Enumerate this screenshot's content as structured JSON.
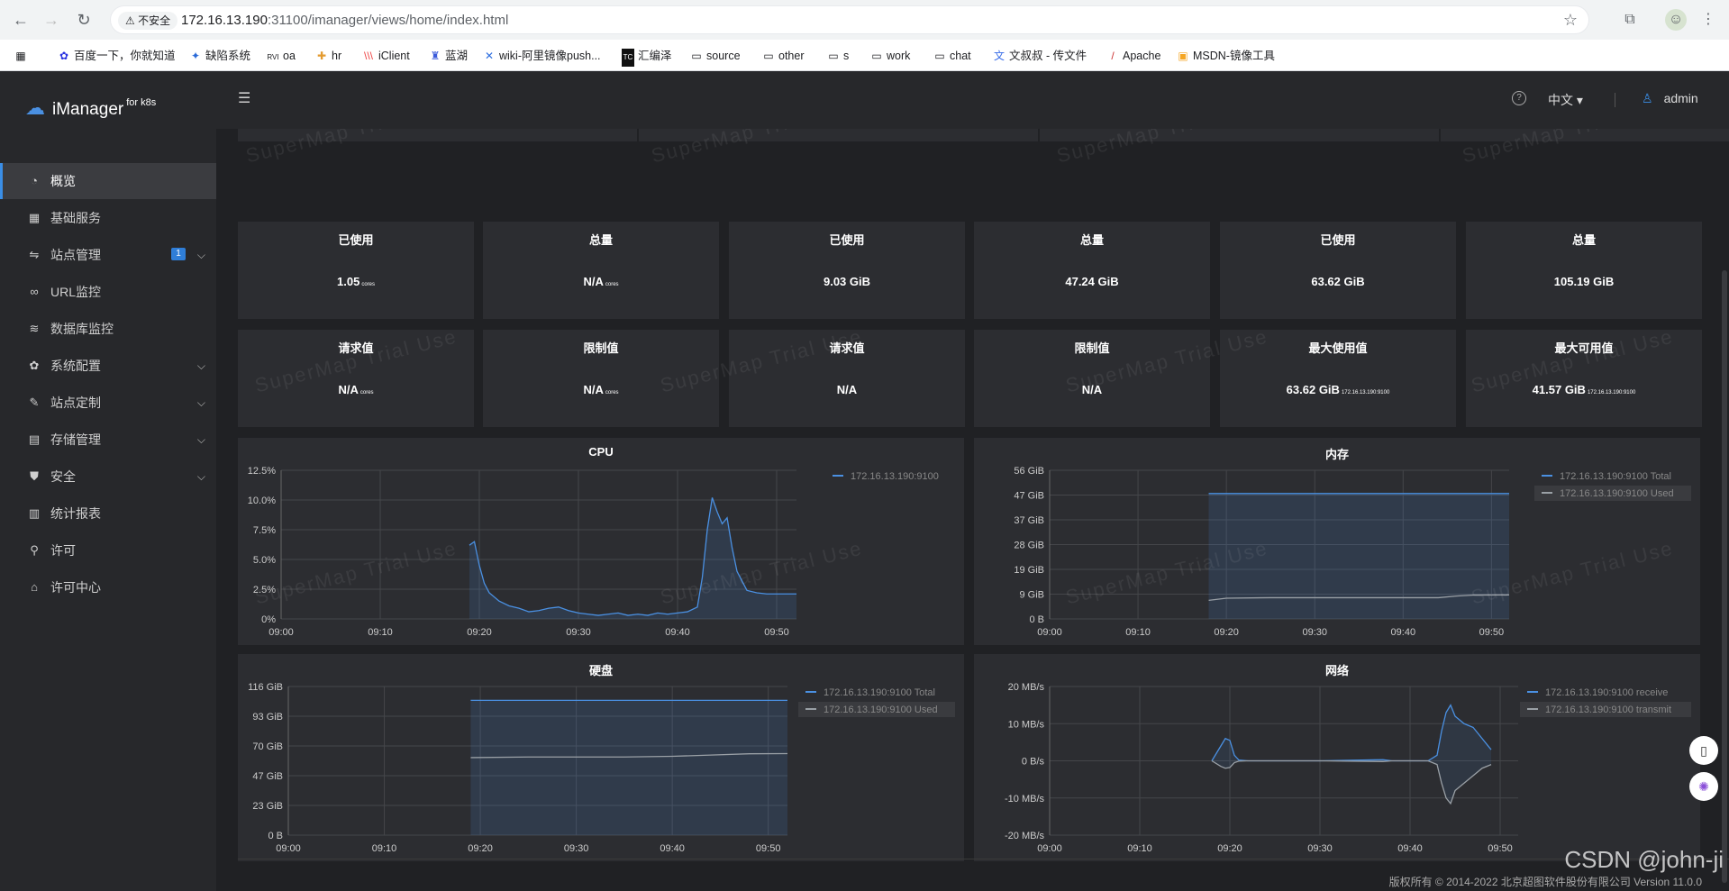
{
  "browser": {
    "security_label": "不安全",
    "url_host": "172.16.13.190",
    "url_rest": ":31100/imanager/views/home/index.html",
    "bookmarks": [
      "百度一下，你就知道",
      "缺陷系统",
      "oa",
      "hr",
      "iClient",
      "蓝湖",
      "wiki-阿里镜像push...",
      "汇编泽",
      "source",
      "other",
      "s",
      "work",
      "chat",
      "文叔叔 - 传文件",
      "Apache",
      "MSDN-镜像工具"
    ]
  },
  "app": {
    "logo_text": "iManager",
    "logo_sup": "for k8s",
    "lang": "中文",
    "user": "admin",
    "help": "?",
    "menu": [
      {
        "label": "概览",
        "active": true,
        "icon": "dashboard-icon"
      },
      {
        "label": "基础服务",
        "icon": "grid-icon"
      },
      {
        "label": "站点管理",
        "icon": "share-icon",
        "badge": "1",
        "expand": true
      },
      {
        "label": "URL监控",
        "icon": "link-icon"
      },
      {
        "label": "数据库监控",
        "icon": "database-icon"
      },
      {
        "label": "系统配置",
        "icon": "gear-icon",
        "expand": true
      },
      {
        "label": "站点定制",
        "icon": "wrench-icon",
        "expand": true
      },
      {
        "label": "存储管理",
        "icon": "storage-icon",
        "expand": true
      },
      {
        "label": "安全",
        "icon": "shield-icon",
        "expand": true
      },
      {
        "label": "统计报表",
        "icon": "report-icon"
      },
      {
        "label": "许可",
        "icon": "license-icon"
      },
      {
        "label": "许可中心",
        "icon": "home-icon"
      }
    ]
  },
  "stats_row1": [
    {
      "label": "已使用",
      "value": "1.05",
      "unit": "cores"
    },
    {
      "label": "总量",
      "value": "N/A",
      "unit": "cores"
    },
    {
      "label": "已使用",
      "value": "9.03 GiB",
      "unit": ""
    },
    {
      "label": "总量",
      "value": "47.24 GiB",
      "unit": ""
    },
    {
      "label": "已使用",
      "value": "63.62 GiB",
      "unit": ""
    },
    {
      "label": "总量",
      "value": "105.19 GiB",
      "unit": ""
    }
  ],
  "stats_row2": [
    {
      "label": "请求值",
      "value": "N/A",
      "unit": "cores"
    },
    {
      "label": "限制值",
      "value": "N/A",
      "unit": "cores"
    },
    {
      "label": "请求值",
      "value": "N/A",
      "unit": ""
    },
    {
      "label": "限制值",
      "value": "N/A",
      "unit": ""
    },
    {
      "label": "最大使用值",
      "value": "63.62 GiB",
      "unit": "172.16.13.190:9100"
    },
    {
      "label": "最大可用值",
      "value": "41.57 GiB",
      "unit": "172.16.13.190:9100"
    }
  ],
  "watermark": "SuperMap Trial Use",
  "footer": "版权所有 © 2014-2022 北京超图软件股份有限公司    Version 11.0.0",
  "overlay_text": "CSDN @john-ji",
  "chart_data": [
    {
      "type": "area",
      "title": "CPU",
      "xticks": [
        "09:00",
        "09:10",
        "09:20",
        "09:30",
        "09:40",
        "09:50"
      ],
      "yticks": [
        "0%",
        "2.5%",
        "5.0%",
        "7.5%",
        "10.0%",
        "12.5%"
      ],
      "ylim": [
        0,
        12.5
      ],
      "xlim": [
        0,
        52
      ],
      "legend_position": "right",
      "series": [
        {
          "name": "172.16.13.190:9100",
          "color": "#4a90e2",
          "x": [
            19,
            19.5,
            20,
            20.5,
            21,
            22,
            23,
            24,
            25,
            26,
            27,
            28,
            29,
            30,
            31,
            32,
            33,
            34,
            35,
            36,
            37,
            38,
            39,
            40,
            41,
            42,
            42.5,
            43,
            43.5,
            44,
            44.5,
            45,
            45.5,
            46,
            47,
            48,
            49,
            50,
            51,
            52
          ],
          "y": [
            6.2,
            6.5,
            4.5,
            3.0,
            2.2,
            1.5,
            1.1,
            0.9,
            0.6,
            0.7,
            0.9,
            1.0,
            0.7,
            0.5,
            0.4,
            0.3,
            0.4,
            0.5,
            0.3,
            0.4,
            0.3,
            0.5,
            0.4,
            0.5,
            0.6,
            1.0,
            3.5,
            7.5,
            10.2,
            9.0,
            8.0,
            8.5,
            6.0,
            4.0,
            2.4,
            2.2,
            2.1,
            2.1,
            2.1,
            2.1
          ]
        }
      ]
    },
    {
      "type": "area",
      "title": "内存",
      "xticks": [
        "09:00",
        "09:10",
        "09:20",
        "09:30",
        "09:40",
        "09:50"
      ],
      "yticks": [
        "0 B",
        "9 GiB",
        "19 GiB",
        "28 GiB",
        "37 GiB",
        "47 GiB",
        "56 GiB"
      ],
      "ylim": [
        0,
        56
      ],
      "xlim": [
        0,
        52
      ],
      "legend_position": "right",
      "series": [
        {
          "name": "172.16.13.190:9100 Total",
          "color": "#4a90e2",
          "x": [
            18,
            52
          ],
          "y": [
            47.24,
            47.24
          ]
        },
        {
          "name": "172.16.13.190:9100 Used",
          "color": "#9aa0a6",
          "x": [
            18,
            20,
            25,
            30,
            35,
            40,
            44,
            46,
            48,
            52
          ],
          "y": [
            7.0,
            7.8,
            8.0,
            8.0,
            8.0,
            8.0,
            8.0,
            8.6,
            9.0,
            9.03
          ]
        }
      ]
    },
    {
      "type": "area",
      "title": "硬盘",
      "xticks": [
        "09:00",
        "09:10",
        "09:20",
        "09:30",
        "09:40",
        "09:50"
      ],
      "yticks": [
        "0 B",
        "23 GiB",
        "47 GiB",
        "70 GiB",
        "93 GiB",
        "116 GiB"
      ],
      "ylim": [
        0,
        116
      ],
      "xlim": [
        0,
        52
      ],
      "legend_position": "right",
      "series": [
        {
          "name": "172.16.13.190:9100 Total",
          "color": "#4a90e2",
          "x": [
            19,
            52
          ],
          "y": [
            105.19,
            105.19
          ]
        },
        {
          "name": "172.16.13.190:9100 Used",
          "color": "#9aa0a6",
          "x": [
            19,
            25,
            30,
            35,
            40,
            44,
            48,
            52
          ],
          "y": [
            60.5,
            61,
            61,
            61,
            61.5,
            62.5,
            63.5,
            63.62
          ]
        }
      ]
    },
    {
      "type": "line",
      "title": "网络",
      "xticks": [
        "09:00",
        "09:10",
        "09:20",
        "09:30",
        "09:40",
        "09:50"
      ],
      "yticks": [
        "-20 MB/s",
        "-10 MB/s",
        "0 B/s",
        "10 MB/s",
        "20 MB/s"
      ],
      "ylim": [
        -20,
        20
      ],
      "xlim": [
        0,
        52
      ],
      "legend_position": "right",
      "series": [
        {
          "name": "172.16.13.190:9100 receive",
          "color": "#4a90e2",
          "x": [
            18,
            19,
            19.5,
            20,
            20.5,
            21,
            22,
            30,
            37,
            38,
            42,
            43,
            43.5,
            44,
            44.5,
            45,
            46,
            47,
            48,
            49
          ],
          "y": [
            0,
            4,
            6,
            5.5,
            1.5,
            0.2,
            0,
            0,
            0.3,
            0,
            0,
            1.5,
            8,
            13,
            15,
            12,
            10,
            9,
            6,
            3
          ]
        },
        {
          "name": "172.16.13.190:9100 transmit",
          "color": "#9aa0a6",
          "x": [
            18,
            19,
            19.5,
            20,
            20.5,
            21,
            22,
            30,
            37,
            38,
            42,
            43,
            43.5,
            44,
            44.5,
            45,
            46,
            47,
            48,
            49
          ],
          "y": [
            0,
            -1.5,
            -2,
            -1.8,
            -0.5,
            -0.1,
            0,
            0,
            -0.2,
            0,
            0,
            -1,
            -6,
            -10,
            -11.5,
            -8,
            -6,
            -4,
            -2,
            -1
          ]
        }
      ]
    }
  ]
}
